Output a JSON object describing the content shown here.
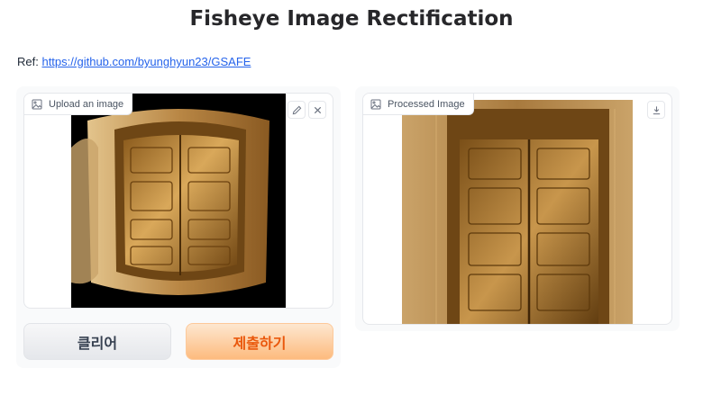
{
  "page": {
    "title": "Fisheye Image Rectification",
    "ref_label": "Ref: ",
    "ref_link": "https://github.com/byunghyun23/GSAFE"
  },
  "input_panel": {
    "label": "Upload an image",
    "label_icon": "image-icon",
    "actions": [
      "edit-icon",
      "close-icon"
    ]
  },
  "output_panel": {
    "label": "Processed Image",
    "label_icon": "image-icon",
    "actions": [
      "download-icon"
    ]
  },
  "buttons": {
    "clear_label": "클리어",
    "submit_label": "제출하기"
  },
  "colors": {
    "link": "#2563eb",
    "submit_text": "#ea580c",
    "submit_bg": "#fdbb7e"
  }
}
